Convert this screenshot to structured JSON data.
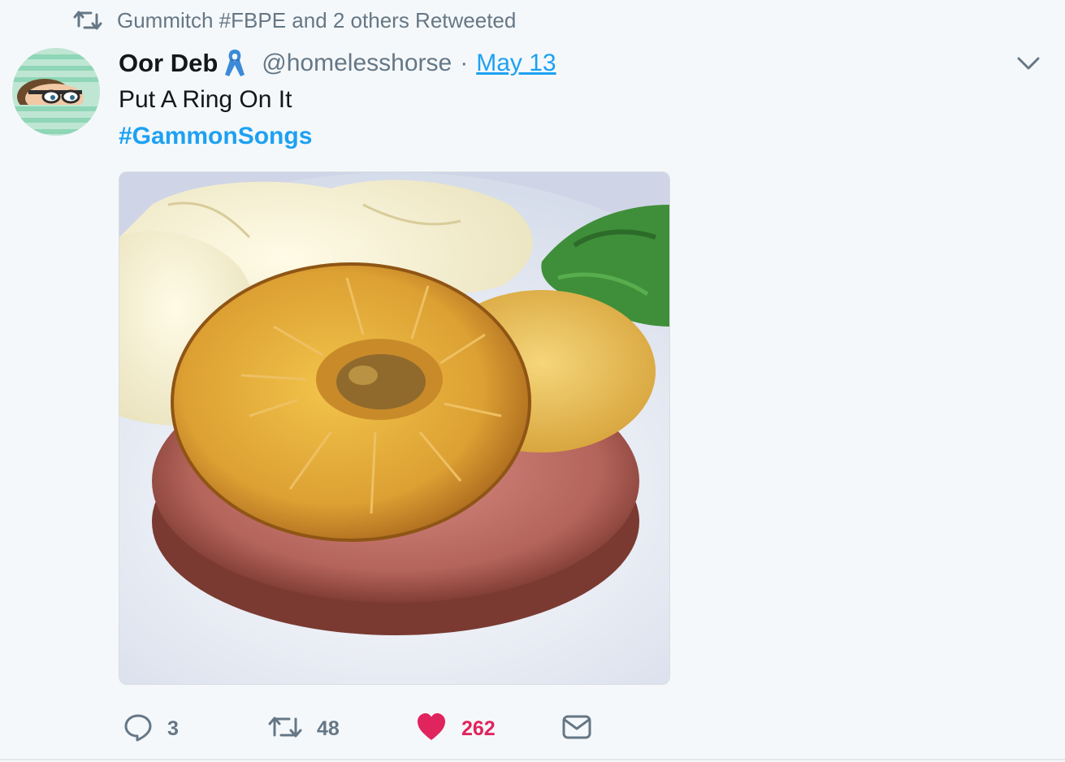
{
  "retweet_context": {
    "text": "Gummitch #FBPE and 2 others Retweeted",
    "icon": "retweet-icon"
  },
  "author": {
    "name": "Oor Deb",
    "badge_icon": "blue-ribbon-icon",
    "handle": "@homelesshorse",
    "separator": "·",
    "date": "May 13"
  },
  "tweet": {
    "text": "Put A Ring On It",
    "hashtag": "#GammonSongs",
    "media_alt": "gammon steak with pineapple ring and mashed potato"
  },
  "actions": {
    "reply_count": "3",
    "retweet_count": "48",
    "like_count": "262",
    "liked": true
  },
  "colors": {
    "link": "#1da1f2",
    "muted": "#657786",
    "like": "#e0245e",
    "background": "#f5f8fa"
  }
}
